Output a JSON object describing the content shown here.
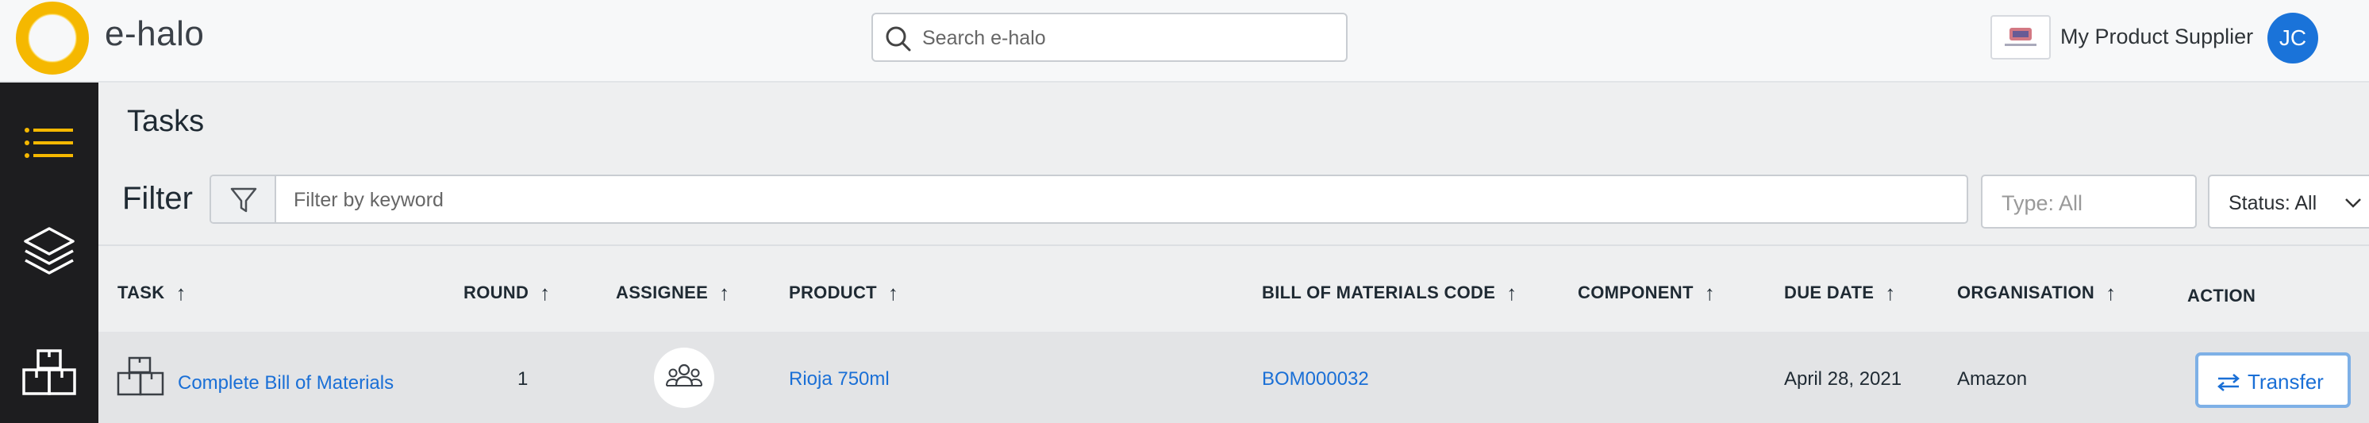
{
  "app": {
    "name": "e-halo"
  },
  "header": {
    "search_placeholder": "Search e-halo",
    "supplier_name": "My Product Supplier",
    "avatar_initials": "JC"
  },
  "sidebar": {
    "items": [
      {
        "icon": "list-icon",
        "active": true
      },
      {
        "icon": "layers-icon",
        "active": false
      },
      {
        "icon": "boxes-icon",
        "active": false
      }
    ]
  },
  "page": {
    "title": "Tasks",
    "filter_label": "Filter",
    "filter_placeholder": "Filter by keyword",
    "type_placeholder": "Type: All",
    "status_value": "Status: All"
  },
  "table": {
    "columns": [
      {
        "label": "TASK",
        "sortable": true
      },
      {
        "label": "ROUND",
        "sortable": true
      },
      {
        "label": "ASSIGNEE",
        "sortable": true
      },
      {
        "label": "PRODUCT",
        "sortable": true
      },
      {
        "label": "BILL OF MATERIALS CODE",
        "sortable": true
      },
      {
        "label": "COMPONENT",
        "sortable": true
      },
      {
        "label": "DUE DATE",
        "sortable": true
      },
      {
        "label": "ORGANISATION",
        "sortable": true
      },
      {
        "label": "ACTION",
        "sortable": false
      }
    ],
    "rows": [
      {
        "task": "Complete Bill of Materials",
        "round": "1",
        "assignee_icon": "group-icon",
        "product": "Rioja 750ml",
        "bom_code": "BOM000032",
        "component": "",
        "due_date": "April 28, 2021",
        "organisation": "Amazon",
        "action": "Transfer"
      }
    ]
  },
  "colors": {
    "accent": "#f5b800",
    "link": "#1a6fd6",
    "avatar": "#1a73d9",
    "sidebar": "#1d1d1f"
  }
}
